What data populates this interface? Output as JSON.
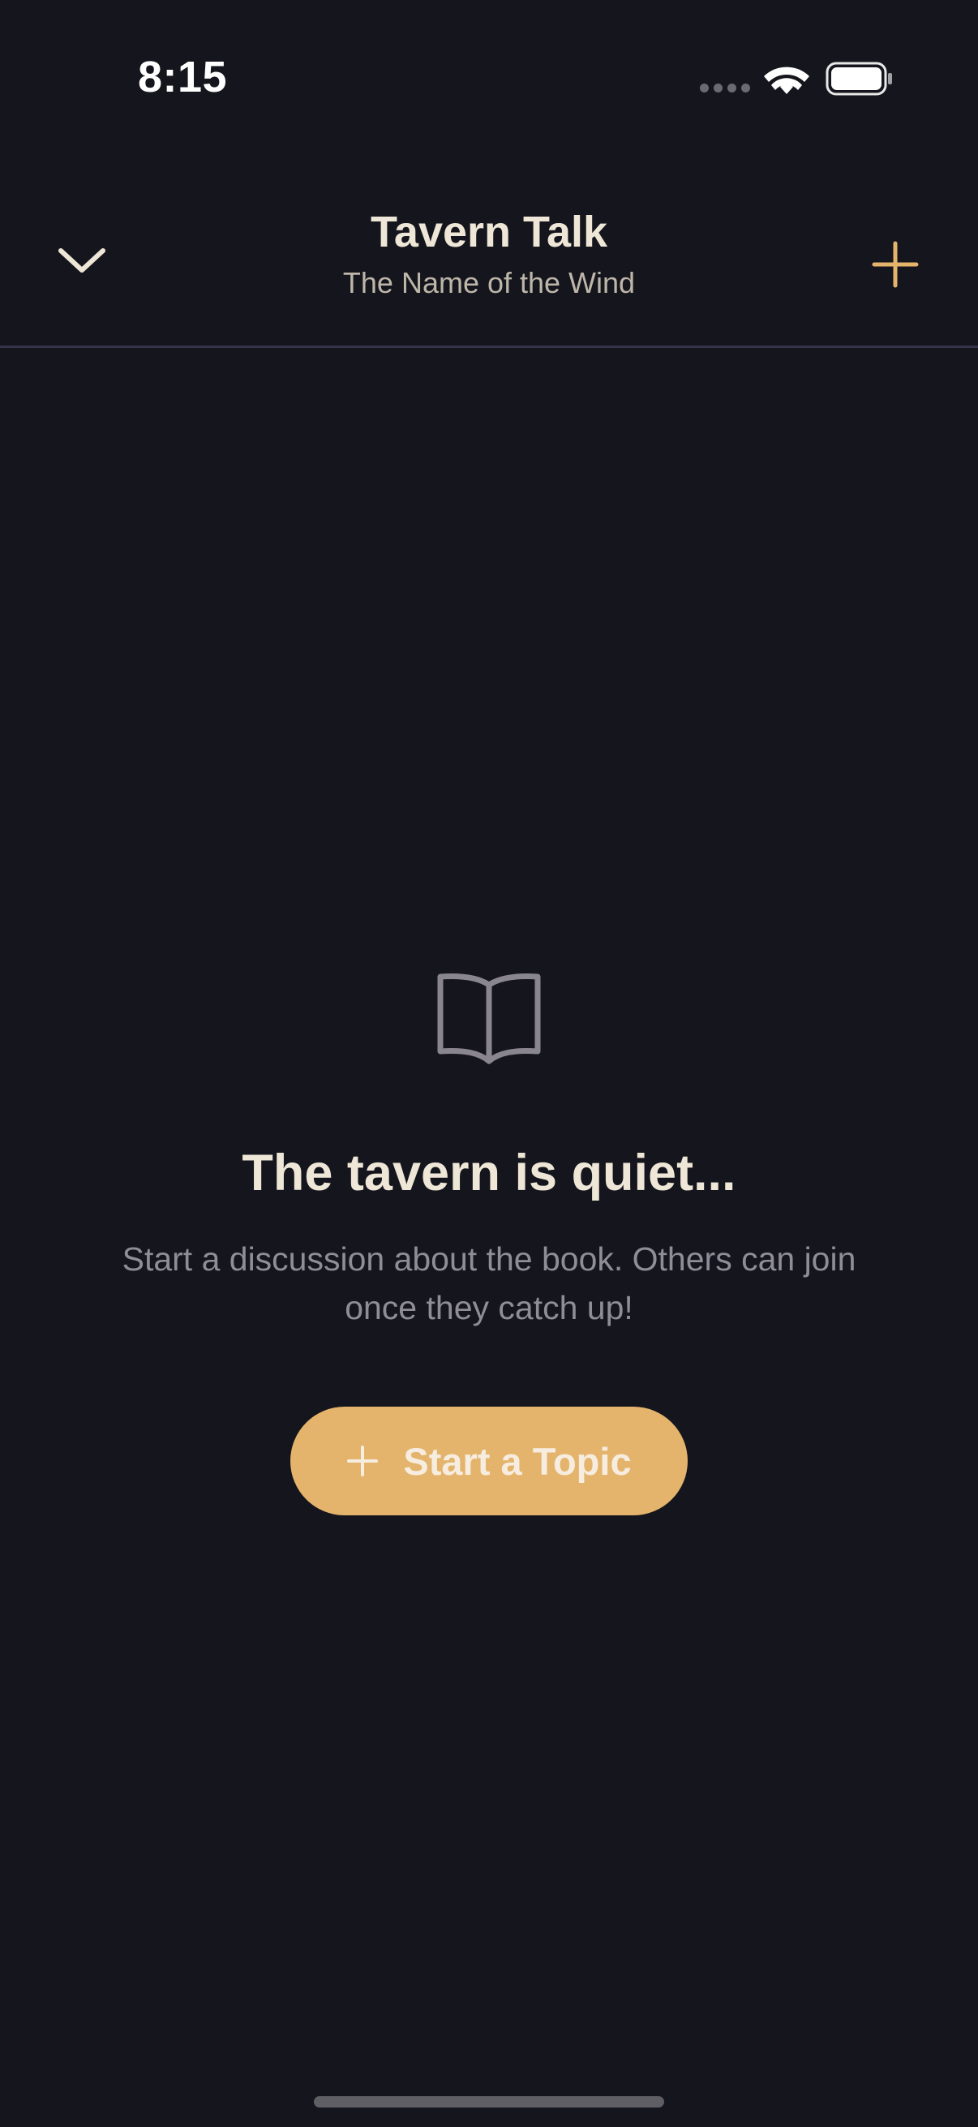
{
  "status_bar": {
    "time": "8:15"
  },
  "header": {
    "title": "Tavern Talk",
    "subtitle": "The Name of the Wind",
    "left_icon": "chevron-down-icon",
    "right_icon": "plus-icon"
  },
  "empty_state": {
    "icon": "book-icon",
    "title": "The tavern is quiet...",
    "description": "Start a discussion about the book. Others can join once they catch up!",
    "button_label": "Start a Topic",
    "button_icon": "plus-icon"
  },
  "colors": {
    "background": "#15151d",
    "accent": "#e4b46c",
    "title_text": "#eee6d6",
    "muted_text": "#8f8d96",
    "divider": "#34344a"
  }
}
